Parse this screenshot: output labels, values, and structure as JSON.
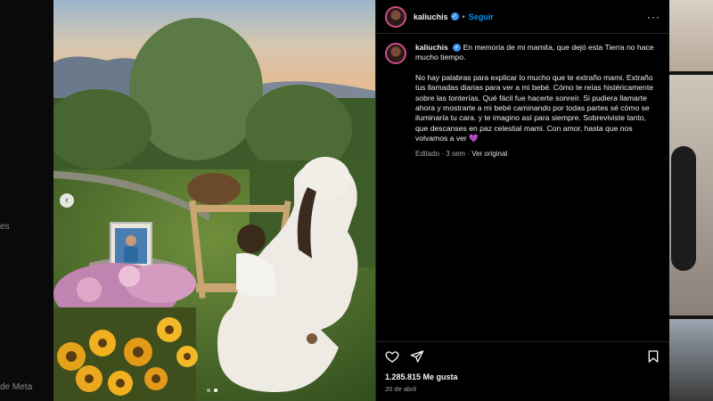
{
  "sidebar": {
    "partial_label_1": "es",
    "partial_label_2": "de Meta"
  },
  "post": {
    "username": "kaliuchis",
    "follow_label": "Seguir",
    "separator": "•",
    "more_icon": "more-horizontal-icon",
    "caption_first": "En memoria de mi mamita, que dejó esta Tierra no hace mucho tiempo.",
    "caption_second": "No hay palabras para explicar lo mucho que te extraño mami. Extraño tus llamadas diarias para ver a mi bebé. Cómo te reías histéricamente sobre las tonterías. Qué fácil fue hacerte sonreír. Si pudiera llamarte ahora y mostrarte a mi bebé caminando por todas partes sé cómo se iluminaría tu cara. y te imagino así para siempre. Sobreviviste tanto, que descanses en paz celestial mami. Con amor, hasta que nos volvamos a ver 💜",
    "edited_label": "Editado",
    "time_ago": "3 sem",
    "see_original": "Ver original",
    "likes": "1.285.815 Me gusta",
    "date": "20 de abril"
  },
  "carousel": {
    "prev_icon": "chevron-left-icon",
    "current": 2,
    "total": 2
  },
  "colors": {
    "accent": "#0095f6",
    "verified": "#3897f0",
    "avatar_ring": "#d24d8a"
  }
}
